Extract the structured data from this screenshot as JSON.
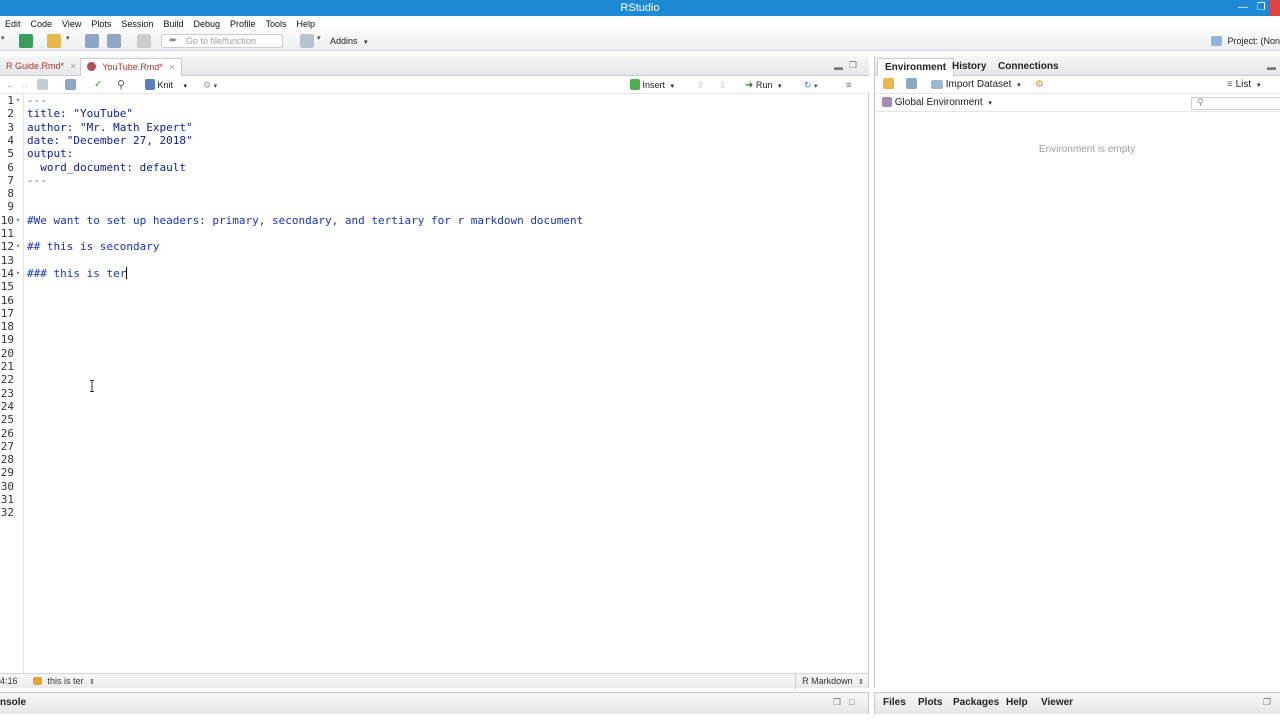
{
  "window": {
    "title": "RStudio"
  },
  "menu": [
    "Edit",
    "Code",
    "View",
    "Plots",
    "Session",
    "Build",
    "Debug",
    "Profile",
    "Tools",
    "Help"
  ],
  "toolbar": {
    "goto_placeholder": "Go to file/function",
    "addins_label": "Addins",
    "project_label": "Project: (Non"
  },
  "source": {
    "tabs": [
      {
        "label": "R Guide.Rmd*"
      },
      {
        "label": "YouTube.Rmd*"
      }
    ],
    "toolbar": {
      "knit_label": "Knit",
      "insert_label": "Insert",
      "run_label": "Run"
    },
    "lines": [
      {
        "n": "1",
        "text": "---"
      },
      {
        "n": "2",
        "text": "title: \"YouTube\""
      },
      {
        "n": "3",
        "text": "author: \"Mr. Math Expert\""
      },
      {
        "n": "4",
        "text": "date: \"December 27, 2018\""
      },
      {
        "n": "5",
        "text": "output:"
      },
      {
        "n": "6",
        "text": "  word_document: default"
      },
      {
        "n": "7",
        "text": "---"
      },
      {
        "n": "8",
        "text": ""
      },
      {
        "n": "9",
        "text": ""
      },
      {
        "n": "10",
        "text": "#We want to set up headers: primary, secondary, and tertiary for r markdown document"
      },
      {
        "n": "11",
        "text": ""
      },
      {
        "n": "12",
        "text": "## this is secondary"
      },
      {
        "n": "13",
        "text": ""
      },
      {
        "n": "14",
        "text": "### this is ter"
      },
      {
        "n": "15",
        "text": ""
      },
      {
        "n": "16",
        "text": ""
      },
      {
        "n": "17",
        "text": ""
      },
      {
        "n": "18",
        "text": ""
      },
      {
        "n": "19",
        "text": ""
      },
      {
        "n": "20",
        "text": ""
      },
      {
        "n": "21",
        "text": ""
      },
      {
        "n": "22",
        "text": ""
      },
      {
        "n": "23",
        "text": ""
      },
      {
        "n": "24",
        "text": ""
      },
      {
        "n": "25",
        "text": ""
      },
      {
        "n": "26",
        "text": ""
      },
      {
        "n": "27",
        "text": ""
      },
      {
        "n": "28",
        "text": ""
      },
      {
        "n": "29",
        "text": ""
      },
      {
        "n": "30",
        "text": ""
      },
      {
        "n": "31",
        "text": ""
      },
      {
        "n": "32",
        "text": ""
      }
    ],
    "status": {
      "position": "4:16",
      "section": "this is ter",
      "mode": "R Markdown"
    }
  },
  "console": {
    "label": "nsole"
  },
  "environment": {
    "tabs": [
      "Environment",
      "History",
      "Connections"
    ],
    "import_label": "Import Dataset",
    "list_label": "List",
    "scope_label": "Global Environment",
    "empty_message": "Environment is empty"
  },
  "files_pane": {
    "tabs": [
      "Files",
      "Plots",
      "Packages",
      "Help",
      "Viewer"
    ]
  },
  "colors": {
    "titlebar": "#1e8ad6",
    "close": "#e04343",
    "rmd_tab": "#a33333",
    "string": "#036a07",
    "heading": "#1a33b5"
  }
}
